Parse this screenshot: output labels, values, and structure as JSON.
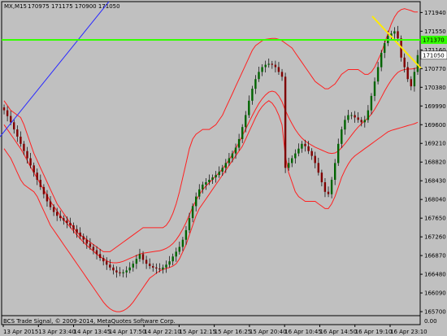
{
  "header": {
    "symbol": "MX,M15",
    "ohlc": "170975 171175 170900 171050"
  },
  "footer": {
    "indicator_caption": "BCS Trade Signal, © 2009-2014, MetaQuotes Software Corp."
  },
  "colors": {
    "background": "#c0c0c0",
    "plot_frame": "#000000",
    "bollinger": "#ff2020",
    "bull_candle": "#006400",
    "bear_candle": "#800000",
    "candle_wick": "#000000",
    "horizontal_level": "#33ff00",
    "trendline_blue": "#2a2aff",
    "trendline_yellow": "#ffea00",
    "price_tag_bg": "#ffffff"
  },
  "chart_data": {
    "type": "candlestick",
    "y_axis_ticks": [
      "171940",
      "171550",
      "171160",
      "170770",
      "170380",
      "169990",
      "169600",
      "169210",
      "168820",
      "168430",
      "168040",
      "167650",
      "167260",
      "166870",
      "166480",
      "166090",
      "165700"
    ],
    "x_axis_ticks": [
      "13 Apr 2015",
      "13 Apr 23:40",
      "14 Apr 13:45",
      "14 Apr 17:50",
      "14 Apr 22:10",
      "15 Apr 12:15",
      "15 Apr 16:25",
      "15 Apr 20:40",
      "16 Apr 10:45",
      "16 Apr 14:50",
      "16 Apr 19:10",
      "16 Apr 23:10"
    ],
    "ylim": [
      165650,
      172150
    ],
    "horizontal_level": {
      "value": 171370,
      "label": "171370"
    },
    "current_price": {
      "value": 171050,
      "label": "171050"
    },
    "indicator_value_label": "0.00",
    "series": [
      {
        "name": "close",
        "values": [
          169900,
          169780,
          169650,
          169500,
          169350,
          169200,
          169050,
          168900,
          168750,
          168600,
          168450,
          168300,
          168150,
          168000,
          167880,
          167780,
          167700,
          167650,
          167600,
          167550,
          167500,
          167420,
          167350,
          167270,
          167200,
          167120,
          167050,
          166980,
          166900,
          166820,
          166750,
          166680,
          166620,
          166560,
          166520,
          166500,
          166520,
          166560,
          166620,
          166700,
          166800,
          166900,
          166780,
          166700,
          166650,
          166620,
          166600,
          166580,
          166620,
          166680,
          166750,
          166850,
          166950,
          167050,
          167200,
          167400,
          167650,
          167900,
          168100,
          168250,
          168350,
          168400,
          168450,
          168500,
          168550,
          168620,
          168700,
          168800,
          168900,
          169000,
          169120,
          169300,
          169550,
          169800,
          170100,
          170350,
          170550,
          170700,
          170800,
          170850,
          170870,
          170850,
          170800,
          170700,
          170600,
          168700,
          168800,
          168900,
          169000,
          169100,
          169200,
          169150,
          169050,
          168950,
          168800,
          168600,
          168400,
          168200,
          168150,
          168450,
          168800,
          169200,
          169500,
          169700,
          169800,
          169800,
          169750,
          169700,
          169650,
          169700,
          169900,
          170200,
          170500,
          170800,
          171100,
          171300,
          171450,
          171500,
          171550,
          171400,
          171000,
          170800,
          170550,
          170400,
          170700,
          171050
        ]
      }
    ],
    "bollinger_upper": [
      170100,
      170000,
      169900,
      169850,
      169800,
      169750,
      169600,
      169400,
      169200,
      169000,
      168850,
      168700,
      168550,
      168400,
      168250,
      168100,
      167950,
      167850,
      167750,
      167650,
      167550,
      167450,
      167350,
      167300,
      167250,
      167200,
      167150,
      167100,
      167050,
      167000,
      166950,
      166950,
      166950,
      167000,
      167050,
      167100,
      167150,
      167200,
      167250,
      167300,
      167350,
      167400,
      167450,
      167450,
      167450,
      167450,
      167450,
      167450,
      167450,
      167500,
      167600,
      167750,
      167950,
      168200,
      168500,
      168800,
      169100,
      169300,
      169400,
      169450,
      169500,
      169500,
      169500,
      169550,
      169600,
      169700,
      169800,
      169950,
      170100,
      170250,
      170400,
      170550,
      170700,
      170850,
      171000,
      171150,
      171250,
      171300,
      171350,
      171380,
      171390,
      171400,
      171400,
      171380,
      171350,
      171300,
      171250,
      171200,
      171100,
      171000,
      170900,
      170800,
      170700,
      170600,
      170500,
      170450,
      170400,
      170350,
      170350,
      170400,
      170450,
      170550,
      170650,
      170700,
      170750,
      170750,
      170750,
      170750,
      170700,
      170650,
      170650,
      170700,
      170800,
      170950,
      171100,
      171300,
      171500,
      171700,
      171850,
      171950,
      172000,
      172020,
      172000,
      171980,
      171950,
      171950
    ],
    "bollinger_middle": [
      169600,
      169500,
      169400,
      169300,
      169200,
      169100,
      168980,
      168850,
      168720,
      168600,
      168480,
      168360,
      168240,
      168120,
      168000,
      167900,
      167800,
      167700,
      167620,
      167540,
      167460,
      167380,
      167300,
      167220,
      167150,
      167080,
      167020,
      166960,
      166900,
      166850,
      166800,
      166760,
      166730,
      166720,
      166720,
      166730,
      166750,
      166780,
      166810,
      166840,
      166870,
      166900,
      166920,
      166930,
      166940,
      166950,
      166960,
      166970,
      166990,
      167020,
      167060,
      167120,
      167200,
      167300,
      167420,
      167560,
      167720,
      167880,
      168020,
      168140,
      168240,
      168320,
      168390,
      168460,
      168530,
      168600,
      168680,
      168770,
      168870,
      168980,
      169100,
      169230,
      169370,
      169510,
      169650,
      169790,
      169920,
      170040,
      170140,
      170220,
      170280,
      170300,
      170280,
      170200,
      170080,
      169900,
      169750,
      169620,
      169500,
      169400,
      169320,
      169260,
      169210,
      169170,
      169130,
      169100,
      169070,
      169040,
      169010,
      169000,
      169010,
      169050,
      169120,
      169200,
      169290,
      169380,
      169470,
      169550,
      169620,
      169680,
      169740,
      169820,
      169920,
      170040,
      170170,
      170300,
      170420,
      170530,
      170620,
      170690,
      170730,
      170750,
      170760,
      170760,
      170770,
      170790
    ],
    "bollinger_lower": [
      169100,
      169000,
      168900,
      168750,
      168600,
      168450,
      168350,
      168300,
      168250,
      168200,
      168100,
      167950,
      167800,
      167650,
      167500,
      167400,
      167300,
      167200,
      167100,
      167000,
      166900,
      166800,
      166700,
      166600,
      166500,
      166400,
      166300,
      166200,
      166100,
      166000,
      165900,
      165820,
      165760,
      165720,
      165700,
      165700,
      165720,
      165760,
      165820,
      165900,
      166000,
      166100,
      166200,
      166300,
      166400,
      166450,
      166500,
      166550,
      166580,
      166600,
      166620,
      166650,
      166700,
      166800,
      166950,
      167100,
      167300,
      167500,
      167700,
      167850,
      167950,
      168050,
      168150,
      168250,
      168350,
      168450,
      168550,
      168650,
      168750,
      168850,
      168950,
      169050,
      169150,
      169300,
      169450,
      169600,
      169750,
      169880,
      169980,
      170050,
      170100,
      170050,
      169950,
      169800,
      169600,
      168950,
      168600,
      168400,
      168200,
      168100,
      168050,
      168000,
      168000,
      168000,
      168000,
      167950,
      167900,
      167850,
      167850,
      167950,
      168100,
      168300,
      168500,
      168650,
      168780,
      168880,
      168950,
      169000,
      169050,
      169100,
      169150,
      169200,
      169250,
      169300,
      169350,
      169400,
      169450,
      169480,
      169500,
      169520,
      169540,
      169560,
      169580,
      169600,
      169620,
      169650
    ]
  }
}
